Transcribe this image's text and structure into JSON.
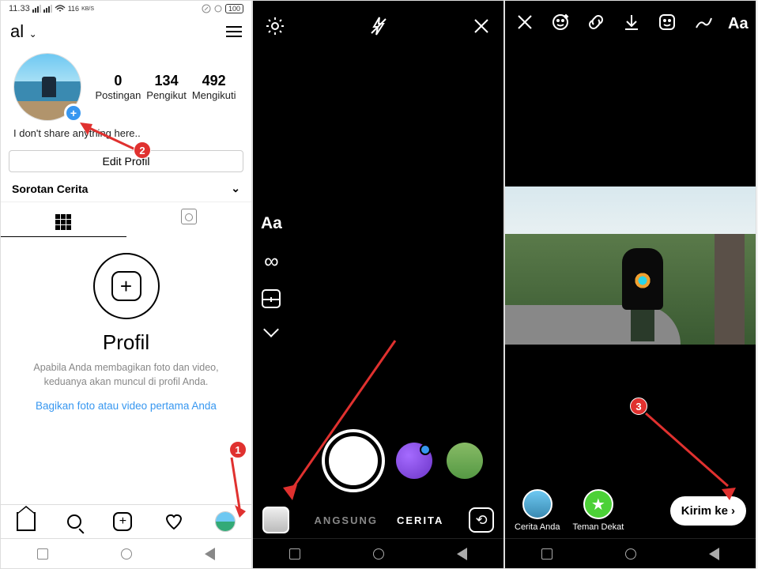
{
  "screen1": {
    "status": {
      "time": "11.33",
      "net": "116",
      "net_unit": "KB/S",
      "battery": "100"
    },
    "username": "al",
    "stats": [
      {
        "n": "0",
        "l": "Postingan"
      },
      {
        "n": "134",
        "l": "Pengikut"
      },
      {
        "n": "492",
        "l": "Mengikuti"
      }
    ],
    "bio": "I don't share anything here..",
    "edit_profile": "Edit Profil",
    "highlights": "Sorotan Cerita",
    "empty_title": "Profil",
    "empty_desc": "Apabila Anda membagikan foto dan video, keduanya akan muncul di profil Anda.",
    "empty_cta": "Bagikan foto atau video pertama Anda",
    "callouts": {
      "c1": "1",
      "c2": "2"
    }
  },
  "screen2": {
    "side_text": "Aa",
    "modes": {
      "live": "ANGSUNG",
      "story": "CERITA"
    }
  },
  "screen3": {
    "top_text": "Aa",
    "your_story": "Cerita Anda",
    "close_friends": "Teman Dekat",
    "send": "Kirim ke",
    "callout": "3"
  }
}
